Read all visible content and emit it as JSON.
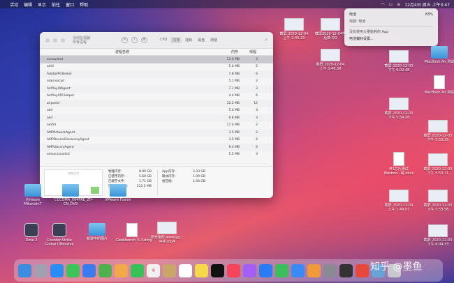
{
  "menubar": {
    "left": [
      "",
      "活动",
      "编辑",
      "显示",
      "前往",
      "窗口",
      "帮助"
    ],
    "right": [
      "",
      "",
      "",
      ".",
      "12月4日 周五 上午3:47"
    ]
  },
  "window": {
    "title": "活动监视器",
    "subtitle": "所有进程",
    "tabs": [
      "CPU",
      "内存",
      "能耗",
      "磁盘",
      "网络"
    ],
    "active_tab": 1,
    "columns": [
      "进程名称",
      "内存",
      "线程"
    ],
    "rows": [
      [
        "accountsd",
        "13.4 MB",
        "3"
      ],
      [
        "adid",
        "5.4 MB",
        "2"
      ],
      [
        "AdobeIPCBroker",
        "7.8 MB",
        "6"
      ],
      [
        "adprivacyd",
        "5.1 MB",
        "2"
      ],
      [
        "AirPlayUIAgent",
        "7.1 MB",
        "3"
      ],
      [
        "AirPlayXPCHelper",
        "4.4 MB",
        "6"
      ],
      [
        "airportd",
        "12.2 MB",
        "12"
      ],
      [
        "akd",
        "5.4 MB",
        "3"
      ],
      [
        "akd",
        "9.8 MB",
        "3"
      ],
      [
        "amfid",
        "17.4 MB",
        "2"
      ],
      [
        "AMPArtworkAgent",
        "3.5 MB",
        "2"
      ],
      [
        "AMPDeviceDiscoveryAgent",
        "3.5 MB",
        "4"
      ],
      [
        "AMPLibraryAgent",
        "9.4 MB",
        "6"
      ],
      [
        "amsaccountsd",
        "5.5 MB",
        "3"
      ]
    ],
    "bottom": {
      "chart_label": "内存压力",
      "stats_left": [
        [
          "物理内存:",
          "8.00 GB"
        ],
        [
          "已使用内存:",
          "5.60 GB"
        ],
        [
          "已缓存文件:",
          "1.71 GB"
        ],
        [
          "已使用的交换:",
          "213.5 MB"
        ]
      ],
      "stats_right": [
        [
          "App内存:",
          "3.33 GB"
        ],
        [
          "联动内存:",
          "1.09 GB"
        ],
        [
          "被压缩:",
          "1.04 GB"
        ]
      ]
    }
  },
  "dropdown": {
    "items": [
      "电池",
      "电源: 电池",
      "没有使用大量能耗的 App",
      "电池偏好设置..."
    ],
    "percent": "83%"
  },
  "desktop": [
    {
      "label": "截屏 2020-12-04 上午 2.45.23"
    },
    {
      "label": "截屏2020-12-04午后数 QQ"
    },
    {
      "label": "截屏 2020-12-04 上午 3.46.38"
    },
    {
      "label": "截屏 2020-12-03 下午 6.02.48"
    },
    {
      "label": "MacBook Air 测试"
    },
    {
      "label": "MacBook Air 测试"
    },
    {
      "label": "截屏 2020-12-03 下午 5.54.26"
    },
    {
      "label": "截屏 2020-12-03 下午 5.53.29"
    },
    {
      "label": "M1芯片测试 Macboo...易.docx"
    },
    {
      "label": "截屏 2020-12-03 下午 5.53.71"
    },
    {
      "label": "截屏 2020-12-04 上午 1.49.07"
    },
    {
      "label": "截屏 2020-12-03 下午 5.53.58"
    },
    {
      "label": "截屏 2020-12-03 下午 6.04.33"
    },
    {
      "label": "Vmware Mikuvain7"
    },
    {
      "label": "CCCOMA_X64FRE_ZH-CN_DV9"
    },
    {
      "label": "VMware Fusion"
    },
    {
      "label": "Dota 2"
    },
    {
      "label": "Counter-Strike Global Offensive"
    },
    {
      "label": "新建中的图片"
    },
    {
      "label": "Geekbench_5.3.dmg"
    },
    {
      "label": "阳光电影 www.yg...中字.mp4"
    }
  ],
  "dock": [
    "Finder",
    "Launchpad",
    "Safari",
    "信息",
    "邮件",
    "地图",
    "照片",
    "FaceTime",
    "4",
    "通讯录",
    "提醒事项",
    "备忘录",
    "TV",
    "音乐",
    "播客",
    "App Store",
    "Numbers",
    "Keynote",
    "Pages",
    "系统偏好设置",
    "活动监视器",
    "WPS",
    "预览",
    "废纸篓"
  ],
  "watermark": "知乎 @墨鱼"
}
